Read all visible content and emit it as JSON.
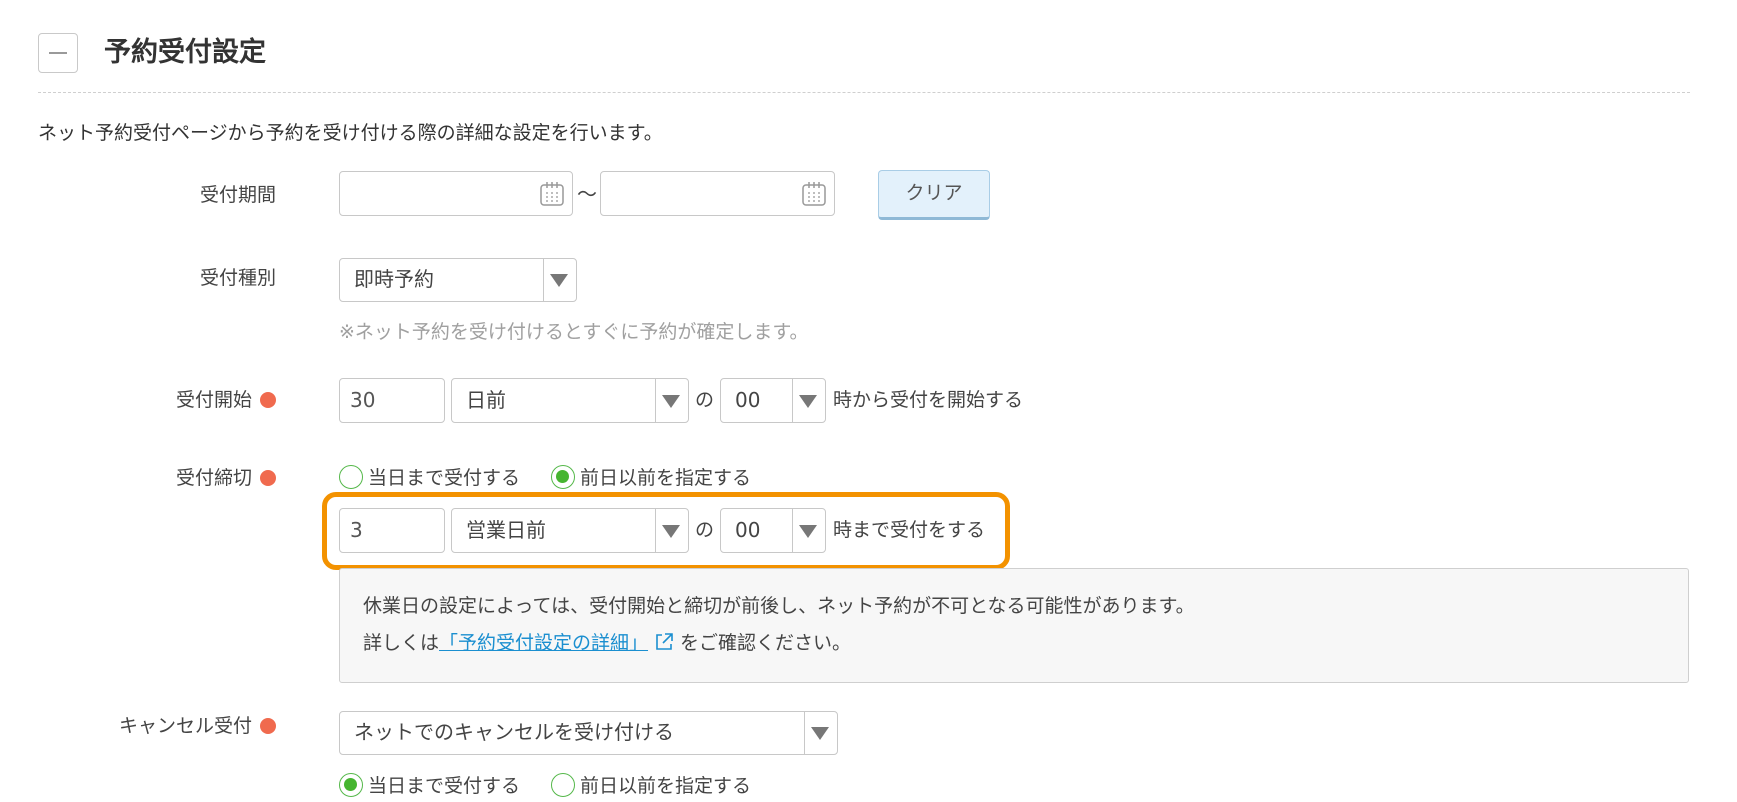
{
  "section": {
    "title": "予約受付設定",
    "description": "ネット予約受付ページから予約を受け付ける際の詳細な設定を行います。"
  },
  "period": {
    "label": "受付期間",
    "start_value": "",
    "end_value": "",
    "separator": "〜",
    "clear_label": "クリア"
  },
  "type": {
    "label": "受付種別",
    "selected": "即時予約",
    "note": "※ネット予約を受け付けるとすぐに予約が確定します。"
  },
  "start": {
    "label": "受付開始",
    "required": true,
    "days_value": "30",
    "unit_selected": "日前",
    "connector": "の",
    "hour_selected": "00",
    "suffix": "時から受付を開始する"
  },
  "deadline": {
    "label": "受付締切",
    "required": true,
    "options": [
      {
        "label": "当日まで受付する",
        "checked": false
      },
      {
        "label": "前日以前を指定する",
        "checked": true
      }
    ],
    "days_value": "3",
    "unit_selected": "営業日前",
    "connector": "の",
    "hour_selected": "00",
    "suffix": "時まで受付をする",
    "info_line1": "休業日の設定によっては、受付開始と締切が前後し、ネット予約が不可となる可能性があります。",
    "info_line2_prefix": "詳しくは",
    "info_link": "「予約受付設定の詳細」",
    "info_line2_suffix": "をご確認ください。"
  },
  "cancel": {
    "label": "キャンセル受付",
    "required": true,
    "selected": "ネットでのキャンセルを受け付ける",
    "options": [
      {
        "label": "当日まで受付する",
        "checked": true
      },
      {
        "label": "前日以前を指定する",
        "checked": false
      }
    ]
  },
  "colors": {
    "required_dot": "#f06a4e",
    "radio_green": "#46b530",
    "highlight": "#f39200",
    "link": "#1b8fd0",
    "clear_button_bg": "#e3f1fb"
  },
  "icons": {
    "collapse": "minus-icon",
    "calendar": "calendar-icon",
    "dropdown": "triangle-down-icon",
    "external_link": "external-link-icon"
  }
}
